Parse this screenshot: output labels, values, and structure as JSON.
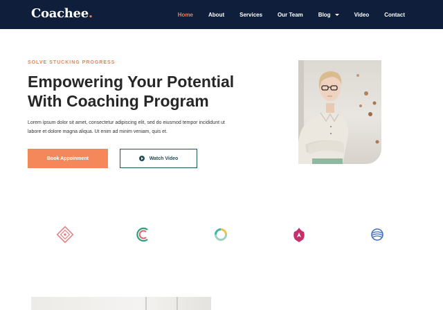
{
  "header": {
    "brand": "Coachee",
    "brand_dot": ".",
    "nav": [
      {
        "label": "Home",
        "active": true
      },
      {
        "label": "About"
      },
      {
        "label": "Services"
      },
      {
        "label": "Our Team"
      },
      {
        "label": "Blog",
        "has_dropdown": true
      },
      {
        "label": "Video"
      },
      {
        "label": "Contact"
      }
    ]
  },
  "hero": {
    "eyebrow": "SOLVE STUCKING PROGRESS",
    "title_line1": "Empowering Your Potential",
    "title_line2": "With Coaching Program",
    "text_line1": "Lorem ipsum dolor sit amet, consectetur adipiscing elit, sed do eiusmod tempor incididunt ut",
    "text_line2": "labore et dolore magna aliqua. Ut enim ad minim veniam, quis et.",
    "primary_button": "Book Appoinment",
    "secondary_button": "Watch Video"
  },
  "partner_logos": [
    "diamond-logo",
    "spiral-c-logo",
    "ring-logo",
    "flame-logo",
    "globe-logo"
  ],
  "colors": {
    "navy": "#0f1e3a",
    "accent": "#f07f4f",
    "button": "#f5885a",
    "teal": "#1f4f54"
  }
}
